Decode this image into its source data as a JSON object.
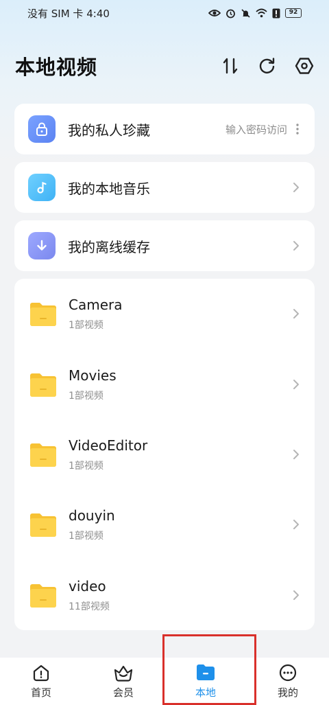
{
  "status_bar": {
    "carrier": "没有 SIM 卡",
    "time": "4:40",
    "battery": "92"
  },
  "header": {
    "title": "本地视频"
  },
  "private": {
    "label": "我的私人珍藏",
    "hint": "输入密码访问"
  },
  "music": {
    "label": "我的本地音乐"
  },
  "offline": {
    "label": "我的离线缓存"
  },
  "folders": [
    {
      "name": "Camera",
      "count": "1部视频"
    },
    {
      "name": "Movies",
      "count": "1部视频"
    },
    {
      "name": "VideoEditor",
      "count": "1部视频"
    },
    {
      "name": "douyin",
      "count": "1部视频"
    },
    {
      "name": "video",
      "count": "11部视频"
    }
  ],
  "nav": [
    {
      "label": "首页"
    },
    {
      "label": "会员"
    },
    {
      "label": "本地"
    },
    {
      "label": "我的"
    }
  ],
  "colors": {
    "accent": "#1e90ea",
    "highlight": "#d9302b",
    "folder": "#fdd24a"
  }
}
